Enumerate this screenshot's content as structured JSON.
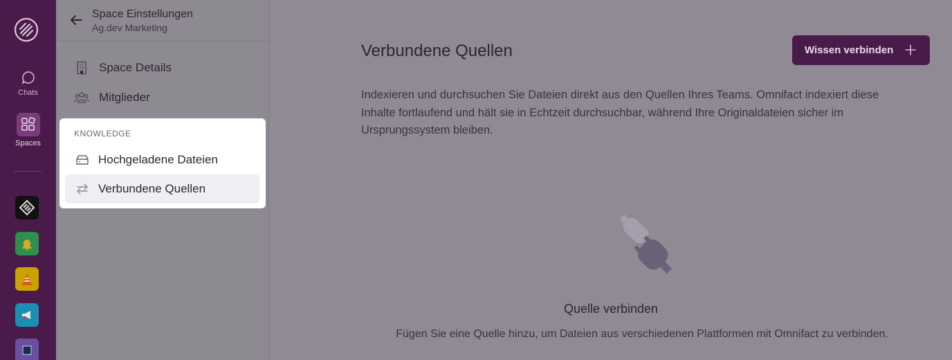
{
  "rail": {
    "nav": [
      {
        "label": "Chats",
        "icon": "chat-bubble-icon"
      },
      {
        "label": "Spaces",
        "icon": "spaces-grid-icon"
      }
    ],
    "spaces": [
      {
        "icon": "diamond-logo-icon",
        "color": "#111111"
      },
      {
        "icon": "bell-icon",
        "color": "#2f8f4e"
      },
      {
        "icon": "traffic-cone-icon",
        "color": "#c9a400"
      },
      {
        "icon": "megaphone-icon",
        "color": "#1b8fb0"
      },
      {
        "icon": "chip-icon",
        "color": "#6b4fa0"
      }
    ]
  },
  "sidebar": {
    "title": "Space Einstellungen",
    "subtitle": "Ag.dev Marketing",
    "items": [
      {
        "label": "Space Details",
        "icon": "building-icon"
      },
      {
        "label": "Mitglieder",
        "icon": "users-icon"
      }
    ],
    "knowledge": {
      "section_label": "KNOWLEDGE",
      "items": [
        {
          "label": "Hochgeladene Dateien",
          "icon": "drive-icon"
        },
        {
          "label": "Verbundene Quellen",
          "icon": "arrows-exchange-icon",
          "active": true
        }
      ]
    }
  },
  "main": {
    "title": "Verbundene Quellen",
    "cta_label": "Wissen verbinden",
    "description": "Indexieren und durchsuchen Sie Dateien direkt aus den Quellen Ihres Teams. Omnifact indexiert diese Inhalte fortlaufend und hält sie in Echtzeit durchsuchbar, während Ihre Originaldateien sicher im Ursprungssystem bleiben.",
    "empty_title": "Quelle verbinden",
    "empty_subtitle": "Fügen Sie eine Quelle hinzu, um Dateien aus verschiedenen Plattformen mit Omnifact zu verbinden."
  },
  "colors": {
    "brand": "#4a1a4b",
    "overlay": "#8f8a93",
    "highlight": "#ffffff"
  }
}
